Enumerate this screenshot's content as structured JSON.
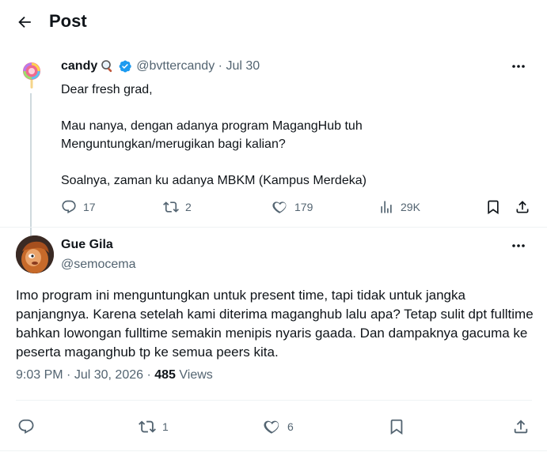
{
  "header": {
    "title": "Post"
  },
  "parent_post": {
    "author_name": "candy",
    "handle": "@bvttercandy",
    "separator": "·",
    "date": "Jul 30",
    "lines": [
      "Dear fresh grad,",
      "",
      "Mau nanya, dengan adanya program MagangHub tuh",
      "Menguntungkan/merugikan bagi kalian?",
      "",
      "Soalnya, zaman ku adanya MBKM (Kampus Merdeka)"
    ],
    "actions": {
      "replies": "17",
      "reposts": "2",
      "likes": "179",
      "views": "29K"
    }
  },
  "reply_post": {
    "author_name": "Gue Gila",
    "handle": "@semocema",
    "text": "Imo program ini menguntungkan untuk present time, tapi tidak untuk jangka panjangnya. Karena setelah kami diterima maganghub lalu apa? Tetap sulit dpt fulltime bahkan lowongan fulltime semakin menipis nyaris gaada. Dan dampaknya gacuma ke peserta maganghub tp ke semua peers kita.",
    "time": "9:03 PM",
    "date": "Jul 30, 2026",
    "views_count": "485",
    "views_label": "Views",
    "actions": {
      "reposts": "1",
      "likes": "6"
    }
  },
  "colors": {
    "text": "#0f1419",
    "secondary": "#536471",
    "verified": "#1d9bf0",
    "divider": "#eff3f4"
  }
}
